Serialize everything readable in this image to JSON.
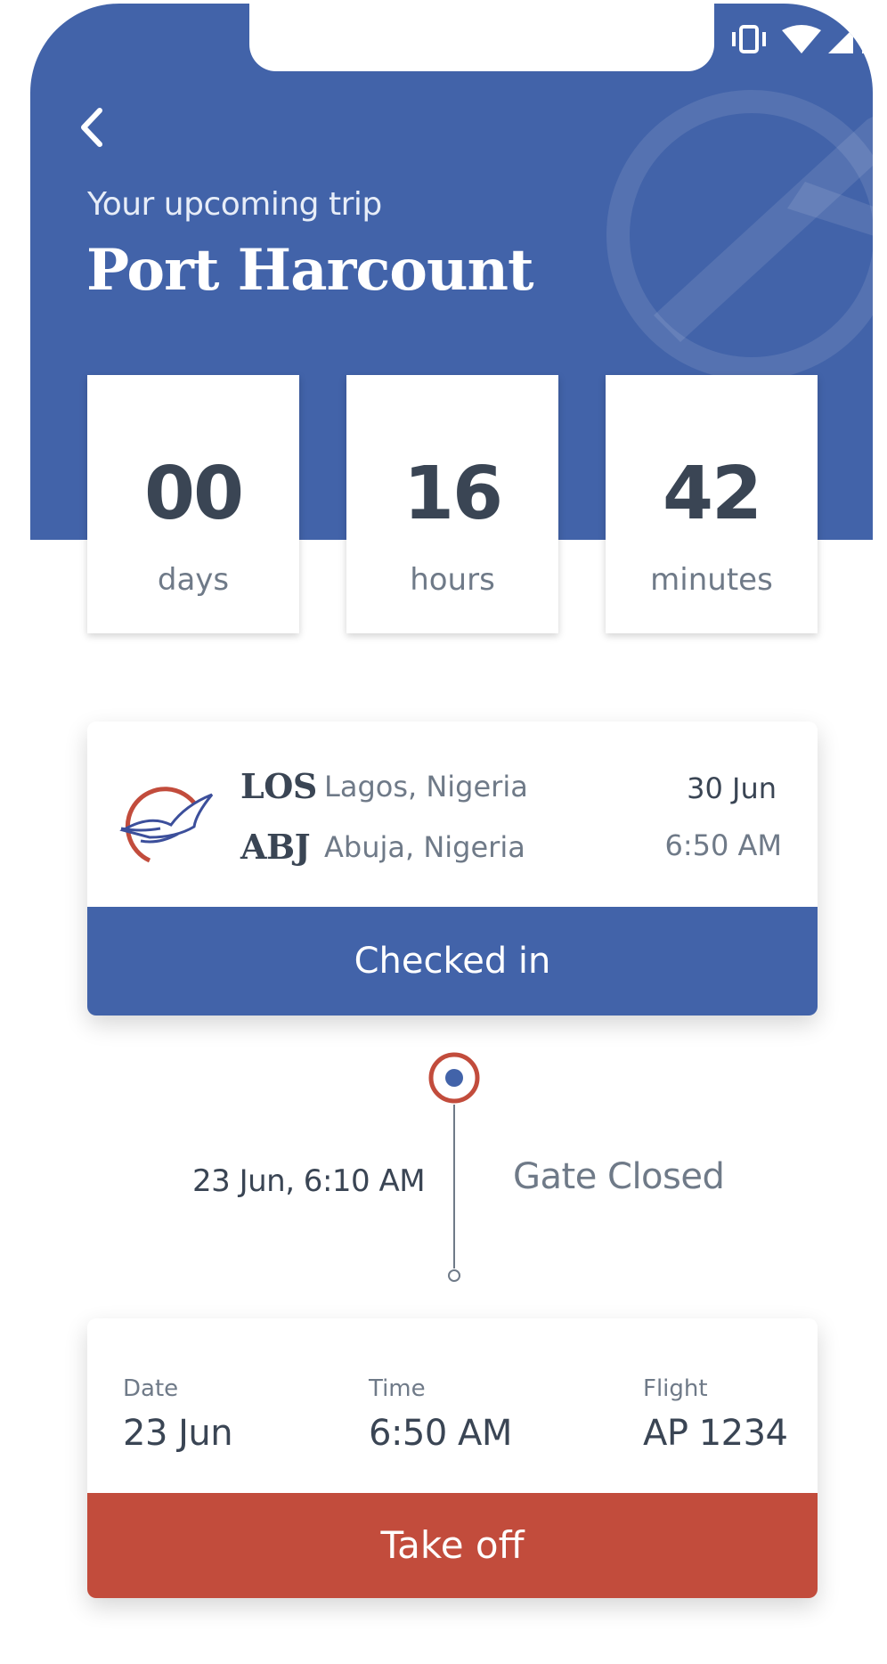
{
  "header": {
    "subtitle": "Your upcoming trip",
    "title": "Port Harcount",
    "background_color": "#4263a9"
  },
  "status_bar": {
    "icons": [
      "vibrate-icon",
      "wifi-icon",
      "signal-icon",
      "battery-icon"
    ]
  },
  "countdown": {
    "days": {
      "value": "00",
      "label": "days"
    },
    "hours": {
      "value": "16",
      "label": "hours"
    },
    "minutes": {
      "value": "42",
      "label": "minutes"
    }
  },
  "route": {
    "origin": {
      "code": "LOS",
      "city": "Lagos, Nigeria"
    },
    "destination": {
      "code": "ABJ",
      "city": "Abuja, Nigeria"
    },
    "date": "30 Jun",
    "time": "6:50 AM",
    "status_label": "Checked in",
    "status_color": "#4263a9"
  },
  "timeline": {
    "time": "23 Jun, 6:10 AM",
    "status": "Gate Closed",
    "accent_color": "#c24c3c"
  },
  "flight": {
    "date_label": "Date",
    "date_value": "23 Jun",
    "time_label": "Time",
    "time_value": "6:50 AM",
    "flight_label": "Flight",
    "flight_value": "AP 1234",
    "action_label": "Take off",
    "action_color": "#c24c3c"
  }
}
